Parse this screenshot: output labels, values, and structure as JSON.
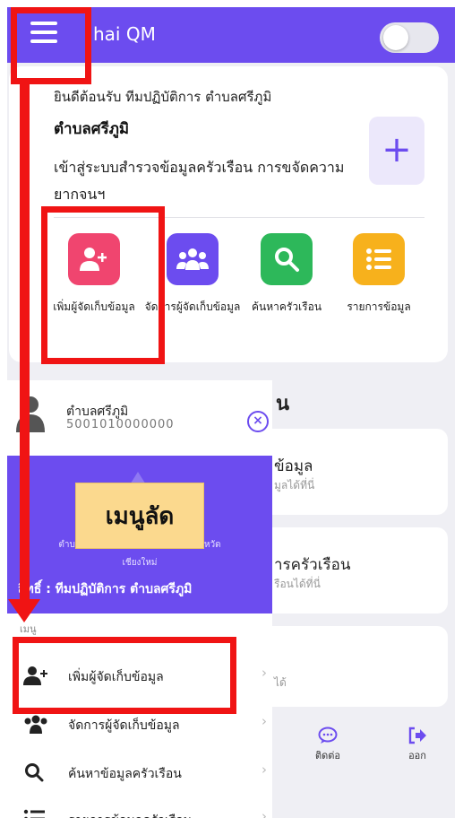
{
  "app": {
    "title": "Thai QM",
    "title_visible": "hai QM"
  },
  "welcome": {
    "greeting": "ยินดีต้อนรับ ทีมปฏิบัติการ ตำบลศรีภูมิ",
    "subdistrict": "ตำบลศรีภูมิ",
    "description": "เข้าสู่ระบบสำรวจข้อมูลครัวเรือน การขจัดความยากจนฯ",
    "add_symbol": "+"
  },
  "quick_actions": [
    {
      "label": "เพิ่มผู้จัดเก็บข้อมูล",
      "icon": "add-user-icon",
      "color": "#f0456f"
    },
    {
      "label": "จัดการผู้จัดเก็บข้อมูล",
      "icon": "users-icon",
      "color": "#6c4cef"
    },
    {
      "label": "ค้นหาครัวเรือน",
      "icon": "search-icon",
      "color": "#2db85a"
    },
    {
      "label": "รายการข้อมูล",
      "icon": "list-icon",
      "color": "#f7b11c"
    }
  ],
  "background_cards": {
    "section_fragment": "น",
    "card1_title": "ข้อมูล",
    "card1_sub": "มูลได้ที่นี่",
    "card2_title": "ารครัวเรือน",
    "card2_sub": "รือนได้ที่นี่",
    "card3_sub": "ได้"
  },
  "bottom_nav": {
    "contact": "ติดต่อ",
    "logout": "ออก"
  },
  "drawer": {
    "user_name": "ตำบลศรีภูมิ",
    "user_id": "5001010000000",
    "close_symbol": "×",
    "place_line1": "ตำบล                                        จังหวัด",
    "place_line2": "เชียงใหม่",
    "role": "สิทธิ์ : ทีมปฏิบัติการ ตำบลศรีภูมิ",
    "menu_caption": "เมนู",
    "menu_items": [
      {
        "label": "เพิ่มผู้จัดเก็บข้อมูล",
        "icon": "add-user-icon"
      },
      {
        "label": "จัดการผู้จัดเก็บข้อมูล",
        "icon": "users-icon"
      },
      {
        "label": "ค้นหาข้อมูลครัวเรือน",
        "icon": "search-icon"
      },
      {
        "label": "รายการข้อมูลครัวเรือน",
        "icon": "list-icon"
      }
    ],
    "chevron": "›"
  },
  "overlay_label": "เมนูลัด",
  "annotation_color": "#f01414",
  "accent_color": "#6c4cef"
}
